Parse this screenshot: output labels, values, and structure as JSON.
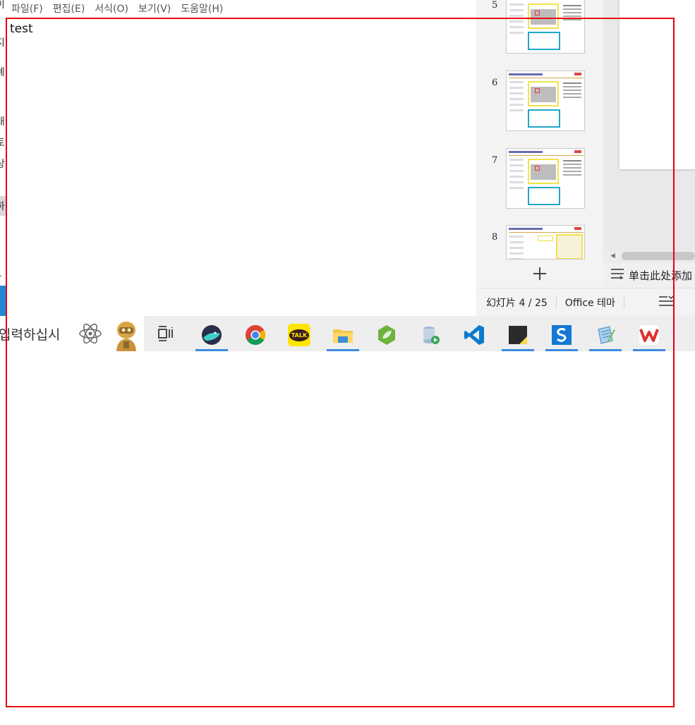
{
  "notepad": {
    "menu": [
      "파일(F)",
      "편집(E)",
      "서식(O)",
      "보기(V)",
      "도움말(H)"
    ],
    "content": "test"
  },
  "background_window": {
    "fragments": [
      "이",
      "-",
      "지",
      "례",
      "대",
      "토",
      "상",
      "하",
      "1"
    ]
  },
  "presentation": {
    "slide_numbers": [
      "5",
      "6",
      "7",
      "8"
    ],
    "add_slide_icon": "plus-icon",
    "notes_placeholder": "单击此处添加",
    "status": {
      "slide_count": "幻灯片 4 / 25",
      "theme": "Office 테마",
      "notes_icon": "notes-icon"
    }
  },
  "taskbar": {
    "search_text": "입력하십시",
    "apps": [
      {
        "name": "whale-browser",
        "running": true
      },
      {
        "name": "chrome",
        "running": false
      },
      {
        "name": "kakaotalk",
        "running": false
      },
      {
        "name": "file-explorer",
        "running": true
      },
      {
        "name": "spring-tool",
        "running": false
      },
      {
        "name": "database-tool",
        "running": false
      },
      {
        "name": "vscode",
        "running": false
      },
      {
        "name": "sticky-notes",
        "running": true
      },
      {
        "name": "s-app",
        "running": true
      },
      {
        "name": "notepad",
        "running": true
      },
      {
        "name": "wps-office",
        "running": true
      }
    ],
    "kakao_label": "TALK"
  },
  "colors": {
    "selection_border": "#e60012",
    "taskbar_running": "#3c8ae0"
  }
}
